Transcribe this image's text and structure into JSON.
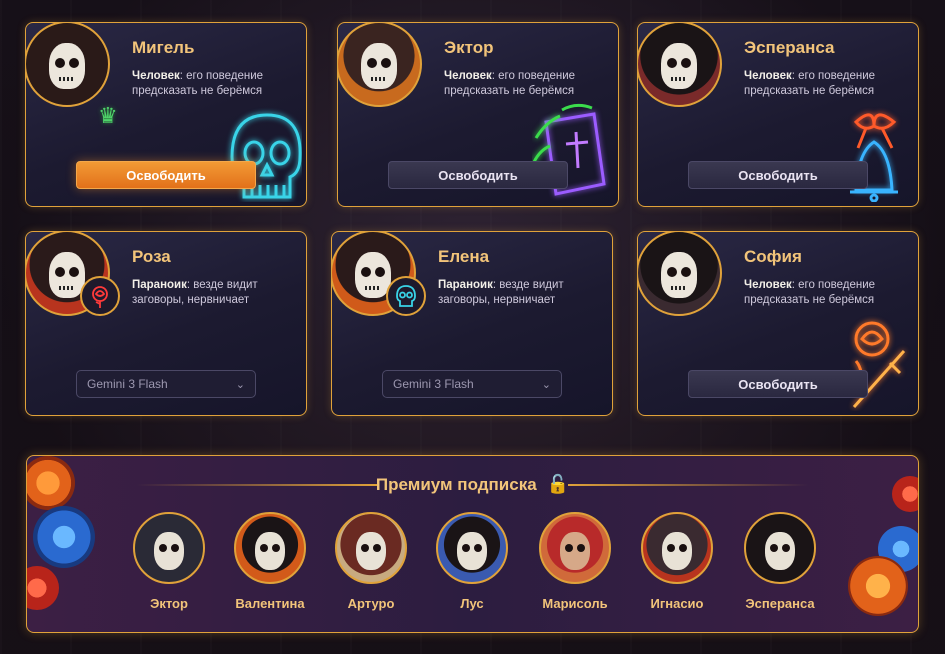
{
  "cards": [
    {
      "name": "Мигель",
      "trait": "Человек",
      "desc": ": его поведение предсказать не берёмся",
      "action": "Освободить",
      "action_type": "primary",
      "neon_icon": "skull-icon"
    },
    {
      "name": "Эктор",
      "trait": "Человек",
      "desc": ": его поведение предсказать не берёмся",
      "action": "Освободить",
      "action_type": "secondary",
      "neon_icon": "bible-icon"
    },
    {
      "name": "Эсперанса",
      "trait": "Человек",
      "desc": ": его поведение предсказать не берёмся",
      "action": "Освободить",
      "action_type": "secondary",
      "neon_icon": "bell-icon"
    },
    {
      "name": "Роза",
      "trait": "Параноик",
      "desc": ": везде видит заговоры, нервничает",
      "model": "Gemini 3 Flash",
      "badge_icon": "rose-icon"
    },
    {
      "name": "Елена",
      "trait": "Параноик",
      "desc": ": везде видит заговоры, нервничает",
      "model": "Gemini 3 Flash",
      "badge_icon": "skull-icon"
    },
    {
      "name": "София",
      "trait": "Человек",
      "desc": ": его поведение предсказать не берёмся",
      "action": "Освободить",
      "action_type": "secondary",
      "neon_icon": "rose-dagger-icon"
    }
  ],
  "premium": {
    "title": "Премиум подписка",
    "lock_icon": "unlock-icon",
    "characters": [
      "Эктор",
      "Валентина",
      "Артуро",
      "Лус",
      "Марисоль",
      "Игнасио",
      "Эсперанса"
    ]
  },
  "colors": {
    "gold": "#e0a23a",
    "name_text": "#f2c47a",
    "primary_button": "#f0892a",
    "card_bg": "#1f1d33",
    "premium_bg": "#2c1d40"
  }
}
